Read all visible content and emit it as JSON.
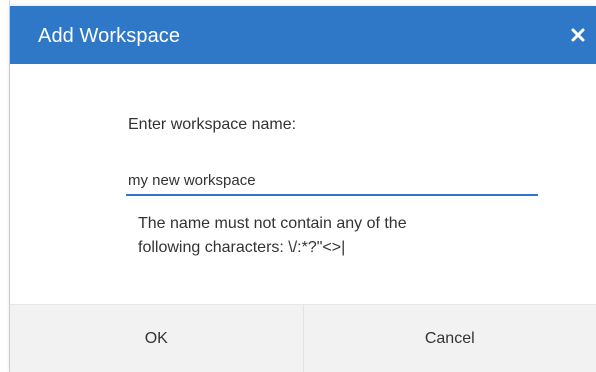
{
  "dialog": {
    "title": "Add Workspace",
    "close_icon": "close-icon",
    "prompt": "Enter workspace name:",
    "input_value": "my new workspace",
    "hint_line1": "The name must not contain any of the",
    "hint_line2": "following characters: \\/:*?\"<>|",
    "ok_label": "OK",
    "cancel_label": "Cancel"
  },
  "colors": {
    "accent": "#2f78c8",
    "footer_bg": "#f2f2f2",
    "text": "#333333"
  }
}
